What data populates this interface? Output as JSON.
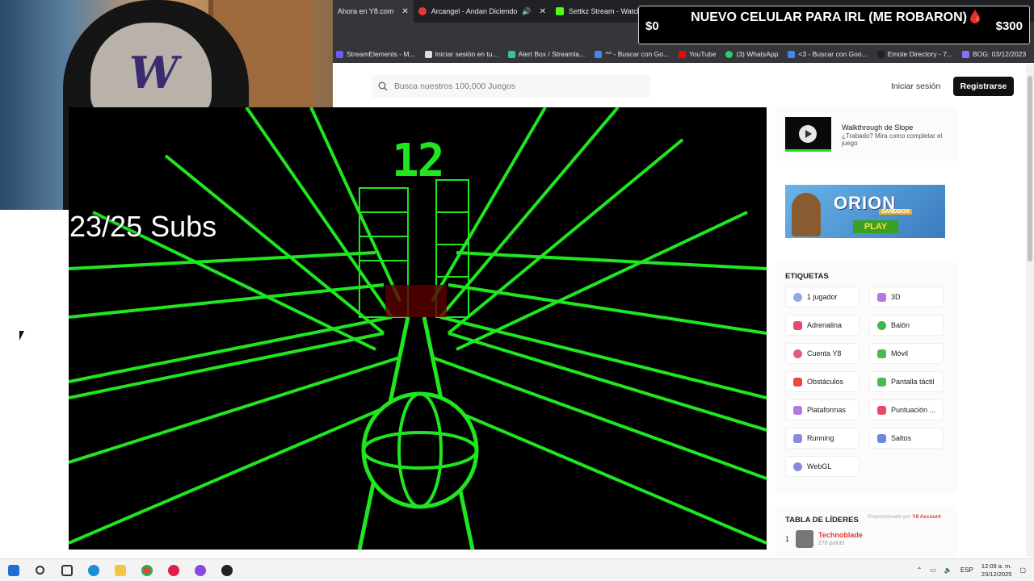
{
  "browser": {
    "tabs": [
      {
        "label": "Ahora en Y8.com",
        "active": true,
        "favicon": "y8-icon"
      },
      {
        "label": "Arcangel - Andan Diciendo",
        "active": false,
        "favicon": "youtube-icon",
        "sound": true
      },
      {
        "label": "Settkz Stream - Watch Live on",
        "active": false,
        "favicon": "kick-icon"
      }
    ],
    "new_tab": "+",
    "bookmarks": [
      {
        "label": "StreamElements - M...",
        "color": "#6b5bff"
      },
      {
        "label": "Iniciar sesión en tu...",
        "color": "#dddddd"
      },
      {
        "label": "Alert Box / Streamla...",
        "color": "#31c3a2"
      },
      {
        "label": "^^ - Buscar con Go...",
        "color": "#4285f4"
      },
      {
        "label": "YouTube",
        "color": "#ff0000"
      },
      {
        "label": "(3) WhatsApp",
        "color": "#25d366"
      },
      {
        "label": "<3 - Buscar con Goo...",
        "color": "#4285f4"
      },
      {
        "label": "Emote Directory - 7...",
        "color": "#222222"
      },
      {
        "label": "BOG: 03/12/2023",
        "color": "#8a6cff"
      }
    ],
    "bookmarks_more": "»"
  },
  "overlay": {
    "title": "NUEVO CELULAR PARA IRL (ME ROBARON)🩸",
    "left_amount": "$0",
    "right_amount": "$300"
  },
  "stream": {
    "subs": "23/25 Subs"
  },
  "game": {
    "score": "12",
    "colors": {
      "track": "#1fe61f",
      "background": "#000000"
    }
  },
  "page": {
    "search_placeholder": "Busca nuestros 100,000 Juegos",
    "login": "Iniciar sesión",
    "register": "Registrarse"
  },
  "sidebar": {
    "walkthrough_title": "Walkthrough de Slope",
    "walkthrough_sub": "¿Trabado? Mira como completar el juego",
    "ad_title": "ORION",
    "ad_sub": "SANDBOX",
    "ad_play": "PLAY",
    "tags_title": "ETIQUETAS",
    "tags": [
      {
        "label": "1 jugador",
        "icon": "person-icon",
        "color": "#8fa8e8"
      },
      {
        "label": "3D",
        "icon": "cube-icon",
        "color": "#b07ae0"
      },
      {
        "label": "Adrenalina",
        "icon": "heart-icon",
        "color": "#e84a6a"
      },
      {
        "label": "Balón",
        "icon": "ball-icon",
        "color": "#3ab84a"
      },
      {
        "label": "Cuenta Y8",
        "icon": "user-icon",
        "color": "#e85a7a"
      },
      {
        "label": "Móvil",
        "icon": "phone-icon",
        "color": "#4ab85a"
      },
      {
        "label": "Obstáculos",
        "icon": "warning-icon",
        "color": "#e84a4a"
      },
      {
        "label": "Pantalla táctil",
        "icon": "touch-icon",
        "color": "#4ab85a"
      },
      {
        "label": "Plataformas",
        "icon": "platform-icon",
        "color": "#b07ae0"
      },
      {
        "label": "Puntuación ...",
        "icon": "score-icon",
        "color": "#e84a6a"
      },
      {
        "label": "Running",
        "icon": "running-icon",
        "color": "#8a8ae0"
      },
      {
        "label": "Saltos",
        "icon": "jump-icon",
        "color": "#6a8ae0"
      },
      {
        "label": "WebGL",
        "icon": "webgl-icon",
        "color": "#8a8ae0"
      }
    ],
    "leaderboard_title": "TABLA DE LÍDERES",
    "leaderboard_powered": "Proporcionado por",
    "leaderboard_brand": "Y8 Account",
    "leaderboard": [
      {
        "rank": "1",
        "name": "Technoblade",
        "points": "276 points"
      }
    ]
  },
  "taskbar": {
    "language": "ESP",
    "time": "12:09 a. m.",
    "date": "23/12/2025"
  }
}
